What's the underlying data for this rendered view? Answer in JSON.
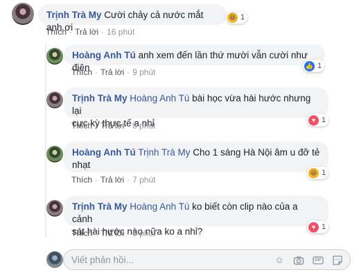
{
  "comments": [
    {
      "author": "Trịnh Trà My",
      "text": "Cười chảy cả nước mắt anh ơi",
      "actions": {
        "like": "Thích",
        "reply": "Trả lời",
        "time": "16 phút"
      },
      "reaction": {
        "icon": "haha-icon",
        "count": "1"
      }
    },
    {
      "author": "Hoàng Anh Tú",
      "text": "anh xem đến lần thứ mười vẫn cười như điên",
      "actions": {
        "like": "Thích",
        "reply": "Trả lời",
        "time": "9 phút"
      },
      "reaction": {
        "icon": "like-icon",
        "count": "1"
      }
    },
    {
      "author": "Trịnh Trà My",
      "tag": "Hoàng Anh Tú",
      "text_line1": "bài học vừa hài hước nhưng lại",
      "text_line2": "cực kỳ thực tế a nhỉ",
      "actions": {
        "like": "Thích",
        "reply": "Trả lời",
        "time": "8 phút"
      },
      "reaction": {
        "icon": "love-icon",
        "count": "1"
      }
    },
    {
      "author": "Hoàng Anh Tú",
      "tag": "Trịnh Trà My",
      "text_line1": "Cho 1 sáng Hà Nội âm u đỡ tẻ",
      "text_line2": "nhạt",
      "actions": {
        "like": "Thích",
        "reply": "Trả lời",
        "time": "7 phút"
      },
      "reaction": {
        "icon": "haha-icon",
        "count": "1"
      }
    },
    {
      "author": "Trịnh Trà My",
      "tag": "Hoàng Anh Tú",
      "text_line1": "ko biết còn clip nào của a cảnh",
      "text_line2": "sát hài hước nào nữa ko a nhỉ?",
      "actions": {
        "like": "Thích",
        "reply": "Trả lời",
        "time": "6 phút"
      },
      "reaction": {
        "icon": "love-icon",
        "count": "1"
      }
    }
  ],
  "reply_box": {
    "placeholder": "Viết phản hồi...",
    "tools": [
      "emoji-icon",
      "camera-icon",
      "gif-icon",
      "sticker-icon"
    ],
    "gif_label": "GIF"
  },
  "colors": {
    "link": "#385898",
    "bubble": "#f2f3f5",
    "meta": "#90949c"
  }
}
